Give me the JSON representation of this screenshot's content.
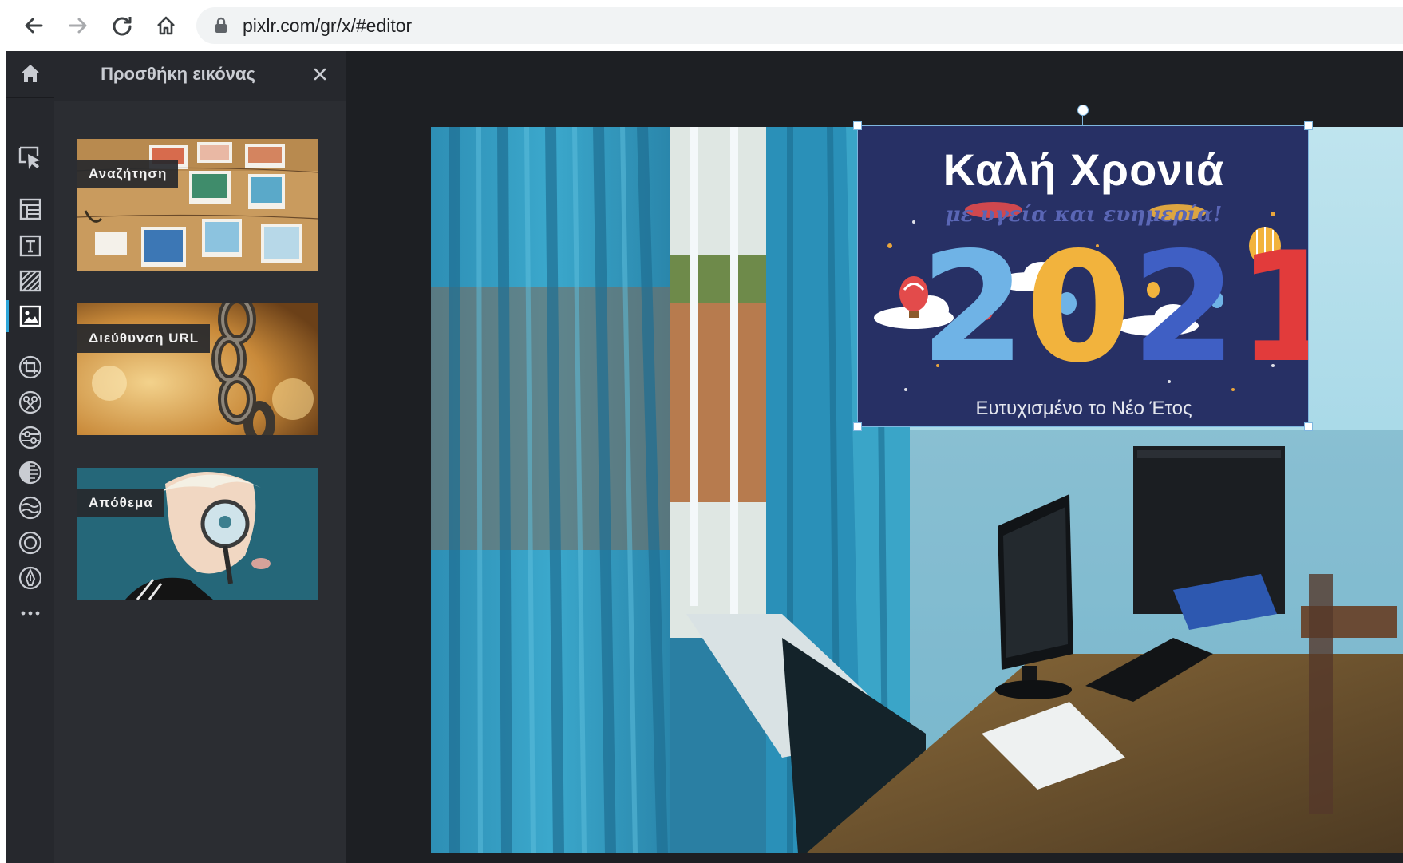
{
  "browser": {
    "url": "pixlr.com/gr/x/#editor"
  },
  "panel": {
    "title": "Προσθήκη εικόνας",
    "sources": [
      {
        "label": "Αναζήτηση"
      },
      {
        "label": "Διεύθυνση URL"
      },
      {
        "label": "Απόθεμα"
      }
    ]
  },
  "layer": {
    "title": "Καλή Χρονιά",
    "subtitle": "με υγεία και ευημερία!",
    "year": [
      "2",
      "0",
      "2",
      "1"
    ],
    "footer": "Ευτυχισμένο το Νέο Έτος"
  },
  "colors": {
    "accent": "#2fa6d9",
    "app_bg": "#1d1f23",
    "panel_bg": "#2b2d32",
    "year_digits": [
      "#6fb3e6",
      "#f2b33d",
      "#3f5fc4",
      "#e23b3b"
    ]
  },
  "icons": {
    "toolbar": [
      "home-icon",
      "arrange-icon",
      "layout-icon",
      "text-icon",
      "pattern-icon",
      "image-icon",
      "crop-icon",
      "cutout-icon",
      "adjust-icon",
      "filter-icon",
      "liquify-icon",
      "focus-icon",
      "draw-icon",
      "more-icon"
    ]
  }
}
